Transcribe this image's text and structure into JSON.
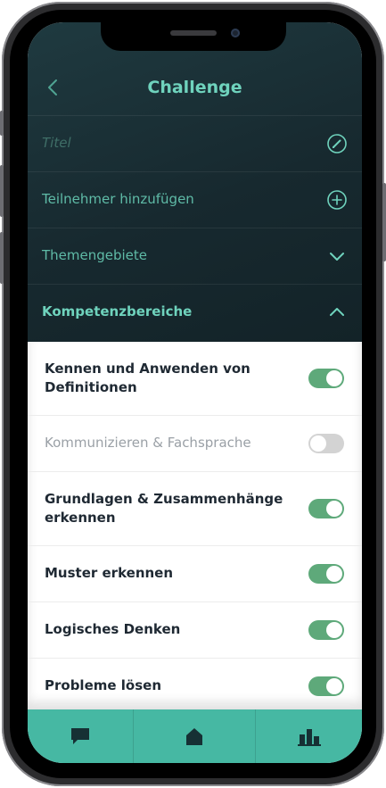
{
  "header": {
    "title": "Challenge"
  },
  "form": {
    "title_placeholder": "Titel",
    "participants_label": "Teilnehmer hinzufügen",
    "topics_label": "Themengebiete",
    "competencies_label": "Kompetenzbereiche"
  },
  "competencies": [
    {
      "line1": "Kennen und Anwenden von",
      "line2": "Definitionen",
      "enabled": true
    },
    {
      "line1": "Kommunizieren & Fachsprache",
      "line2": "",
      "enabled": false
    },
    {
      "line1": "Grundlagen & Zusammenhänge",
      "line2": "erkennen",
      "enabled": true
    },
    {
      "line1": "Muster erkennen",
      "line2": "",
      "enabled": true
    },
    {
      "line1": "Logisches Denken",
      "line2": "",
      "enabled": true
    },
    {
      "line1": "Probleme lösen",
      "line2": "",
      "enabled": true
    }
  ],
  "icons": {
    "back": "chevron-left-icon",
    "edit": "pencil-circle-icon",
    "add": "plus-circle-icon",
    "expand": "chevron-down-icon",
    "collapse": "chevron-up-icon",
    "tabs": [
      "chat-icon",
      "home-icon",
      "leaderboard-icon"
    ]
  },
  "colors": {
    "accent": "#6fd3bd",
    "toggle_on": "#5ea97a",
    "toggle_off": "#d3d3d3",
    "tabbar": "#46b8a3",
    "header_bg": "#1b3035"
  }
}
